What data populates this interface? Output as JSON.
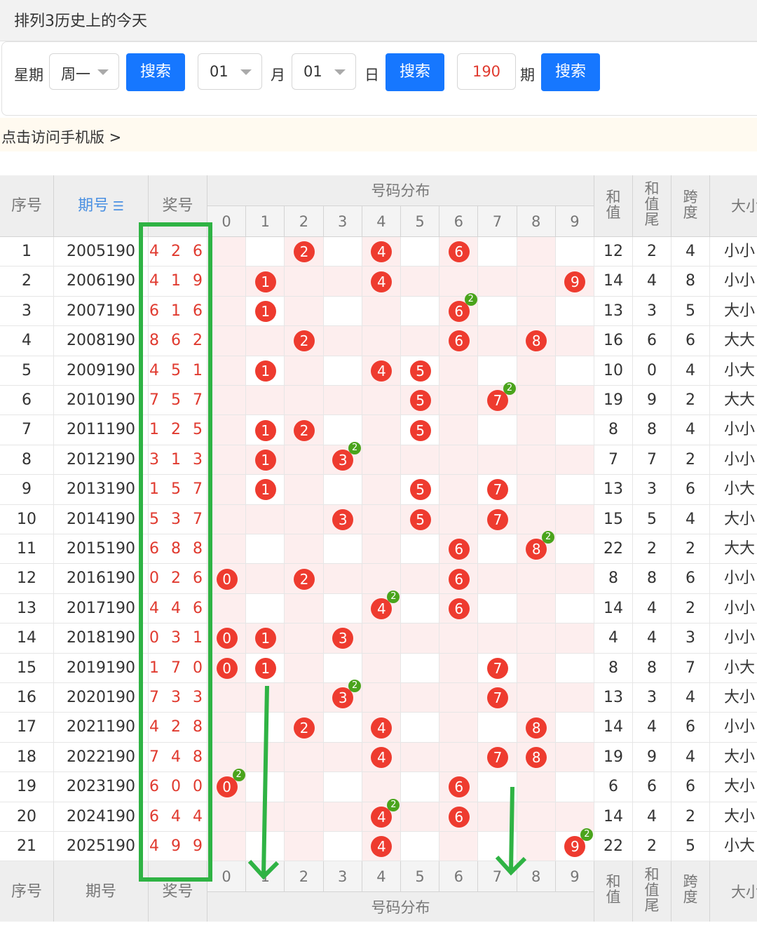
{
  "header": {
    "title": "排列3历史上的今天"
  },
  "search": {
    "weekday_label": "星期",
    "weekday_value": "周一",
    "search1": "搜索",
    "month_value": "01",
    "month_label": "月",
    "day_value": "01",
    "day_label": "日",
    "search2": "搜索",
    "period_value": "190",
    "period_label": "期",
    "search3": "搜索"
  },
  "mobile_link": "点击访问手机版 >",
  "table": {
    "headers": {
      "seq": "序号",
      "period": "期号",
      "sort_icon": "sort-icon",
      "award": "奖号",
      "dist": "号码分布",
      "sum": "和值",
      "sum_tail": "和值尾",
      "span": "跨度",
      "size": "大小"
    },
    "digits": [
      "0",
      "1",
      "2",
      "3",
      "4",
      "5",
      "6",
      "7",
      "8",
      "9"
    ],
    "rows": [
      {
        "seq": "1",
        "period": "2005190",
        "award": "4 2 6",
        "sum": "12",
        "tail": "2",
        "span": "4",
        "size": "小小",
        "balls": [
          {
            "d": 2,
            "l": "2"
          },
          {
            "d": 4,
            "l": "4"
          },
          {
            "d": 6,
            "l": "6"
          }
        ]
      },
      {
        "seq": "2",
        "period": "2006190",
        "award": "4 1 9",
        "sum": "14",
        "tail": "4",
        "span": "8",
        "size": "小小",
        "balls": [
          {
            "d": 1,
            "l": "1"
          },
          {
            "d": 4,
            "l": "4"
          },
          {
            "d": 9,
            "l": "9"
          }
        ]
      },
      {
        "seq": "3",
        "period": "2007190",
        "award": "6 1 6",
        "sum": "13",
        "tail": "3",
        "span": "5",
        "size": "大小",
        "balls": [
          {
            "d": 1,
            "l": "1"
          },
          {
            "d": 6,
            "l": "6",
            "b": "2"
          }
        ]
      },
      {
        "seq": "4",
        "period": "2008190",
        "award": "8 6 2",
        "sum": "16",
        "tail": "6",
        "span": "6",
        "size": "大大",
        "balls": [
          {
            "d": 2,
            "l": "2"
          },
          {
            "d": 6,
            "l": "6"
          },
          {
            "d": 8,
            "l": "8"
          }
        ]
      },
      {
        "seq": "5",
        "period": "2009190",
        "award": "4 5 1",
        "sum": "10",
        "tail": "0",
        "span": "4",
        "size": "小大",
        "balls": [
          {
            "d": 1,
            "l": "1"
          },
          {
            "d": 4,
            "l": "4"
          },
          {
            "d": 5,
            "l": "5"
          }
        ]
      },
      {
        "seq": "6",
        "period": "2010190",
        "award": "7 5 7",
        "sum": "19",
        "tail": "9",
        "span": "2",
        "size": "大大",
        "balls": [
          {
            "d": 5,
            "l": "5"
          },
          {
            "d": 7,
            "l": "7",
            "b": "2"
          }
        ]
      },
      {
        "seq": "7",
        "period": "2011190",
        "award": "1 2 5",
        "sum": "8",
        "tail": "8",
        "span": "4",
        "size": "小小",
        "balls": [
          {
            "d": 1,
            "l": "1"
          },
          {
            "d": 2,
            "l": "2"
          },
          {
            "d": 5,
            "l": "5"
          }
        ]
      },
      {
        "seq": "8",
        "period": "2012190",
        "award": "3 1 3",
        "sum": "7",
        "tail": "7",
        "span": "2",
        "size": "小小",
        "balls": [
          {
            "d": 1,
            "l": "1"
          },
          {
            "d": 3,
            "l": "3",
            "b": "2"
          }
        ]
      },
      {
        "seq": "9",
        "period": "2013190",
        "award": "1 5 7",
        "sum": "13",
        "tail": "3",
        "span": "6",
        "size": "小大",
        "balls": [
          {
            "d": 1,
            "l": "1"
          },
          {
            "d": 5,
            "l": "5"
          },
          {
            "d": 7,
            "l": "7"
          }
        ]
      },
      {
        "seq": "10",
        "period": "2014190",
        "award": "5 3 7",
        "sum": "15",
        "tail": "5",
        "span": "4",
        "size": "大小",
        "balls": [
          {
            "d": 3,
            "l": "3"
          },
          {
            "d": 5,
            "l": "5"
          },
          {
            "d": 7,
            "l": "7"
          }
        ]
      },
      {
        "seq": "11",
        "period": "2015190",
        "award": "6 8 8",
        "sum": "22",
        "tail": "2",
        "span": "2",
        "size": "大大",
        "balls": [
          {
            "d": 6,
            "l": "6"
          },
          {
            "d": 8,
            "l": "8",
            "b": "2"
          }
        ]
      },
      {
        "seq": "12",
        "period": "2016190",
        "award": "0 2 6",
        "sum": "8",
        "tail": "8",
        "span": "6",
        "size": "小小",
        "balls": [
          {
            "d": 0,
            "l": "0"
          },
          {
            "d": 2,
            "l": "2"
          },
          {
            "d": 6,
            "l": "6"
          }
        ]
      },
      {
        "seq": "13",
        "period": "2017190",
        "award": "4 4 6",
        "sum": "14",
        "tail": "4",
        "span": "2",
        "size": "小小",
        "balls": [
          {
            "d": 4,
            "l": "4",
            "b": "2"
          },
          {
            "d": 6,
            "l": "6"
          }
        ]
      },
      {
        "seq": "14",
        "period": "2018190",
        "award": "0 3 1",
        "sum": "4",
        "tail": "4",
        "span": "3",
        "size": "小小",
        "balls": [
          {
            "d": 0,
            "l": "0"
          },
          {
            "d": 1,
            "l": "1"
          },
          {
            "d": 3,
            "l": "3"
          }
        ]
      },
      {
        "seq": "15",
        "period": "2019190",
        "award": "1 7 0",
        "sum": "8",
        "tail": "8",
        "span": "7",
        "size": "小大",
        "balls": [
          {
            "d": 0,
            "l": "0"
          },
          {
            "d": 1,
            "l": "1"
          },
          {
            "d": 7,
            "l": "7"
          }
        ]
      },
      {
        "seq": "16",
        "period": "2020190",
        "award": "7 3 3",
        "sum": "13",
        "tail": "3",
        "span": "4",
        "size": "大小",
        "balls": [
          {
            "d": 3,
            "l": "3",
            "b": "2"
          },
          {
            "d": 7,
            "l": "7"
          }
        ]
      },
      {
        "seq": "17",
        "period": "2021190",
        "award": "4 2 8",
        "sum": "14",
        "tail": "4",
        "span": "6",
        "size": "小小",
        "balls": [
          {
            "d": 2,
            "l": "2"
          },
          {
            "d": 4,
            "l": "4"
          },
          {
            "d": 8,
            "l": "8"
          }
        ]
      },
      {
        "seq": "18",
        "period": "2022190",
        "award": "7 4 8",
        "sum": "19",
        "tail": "9",
        "span": "4",
        "size": "大小",
        "balls": [
          {
            "d": 4,
            "l": "4"
          },
          {
            "d": 7,
            "l": "7"
          },
          {
            "d": 8,
            "l": "8"
          }
        ]
      },
      {
        "seq": "19",
        "period": "2023190",
        "award": "6 0 0",
        "sum": "6",
        "tail": "6",
        "span": "6",
        "size": "大小",
        "balls": [
          {
            "d": 0,
            "l": "0",
            "b": "2"
          },
          {
            "d": 6,
            "l": "6"
          }
        ]
      },
      {
        "seq": "20",
        "period": "2024190",
        "award": "6 4 4",
        "sum": "14",
        "tail": "4",
        "span": "2",
        "size": "大小",
        "balls": [
          {
            "d": 4,
            "l": "4",
            "b": "2"
          },
          {
            "d": 6,
            "l": "6"
          }
        ]
      },
      {
        "seq": "21",
        "period": "2025190",
        "award": "4 9 9",
        "sum": "22",
        "tail": "2",
        "span": "5",
        "size": "小大",
        "balls": [
          {
            "d": 4,
            "l": "4"
          },
          {
            "d": 9,
            "l": "9",
            "b": "2"
          }
        ]
      }
    ]
  },
  "annotation_color": "#2fb344",
  "ball_color": "#ee3b2f",
  "badge_color": "#4aa41c",
  "accent_color": "#1677ff"
}
